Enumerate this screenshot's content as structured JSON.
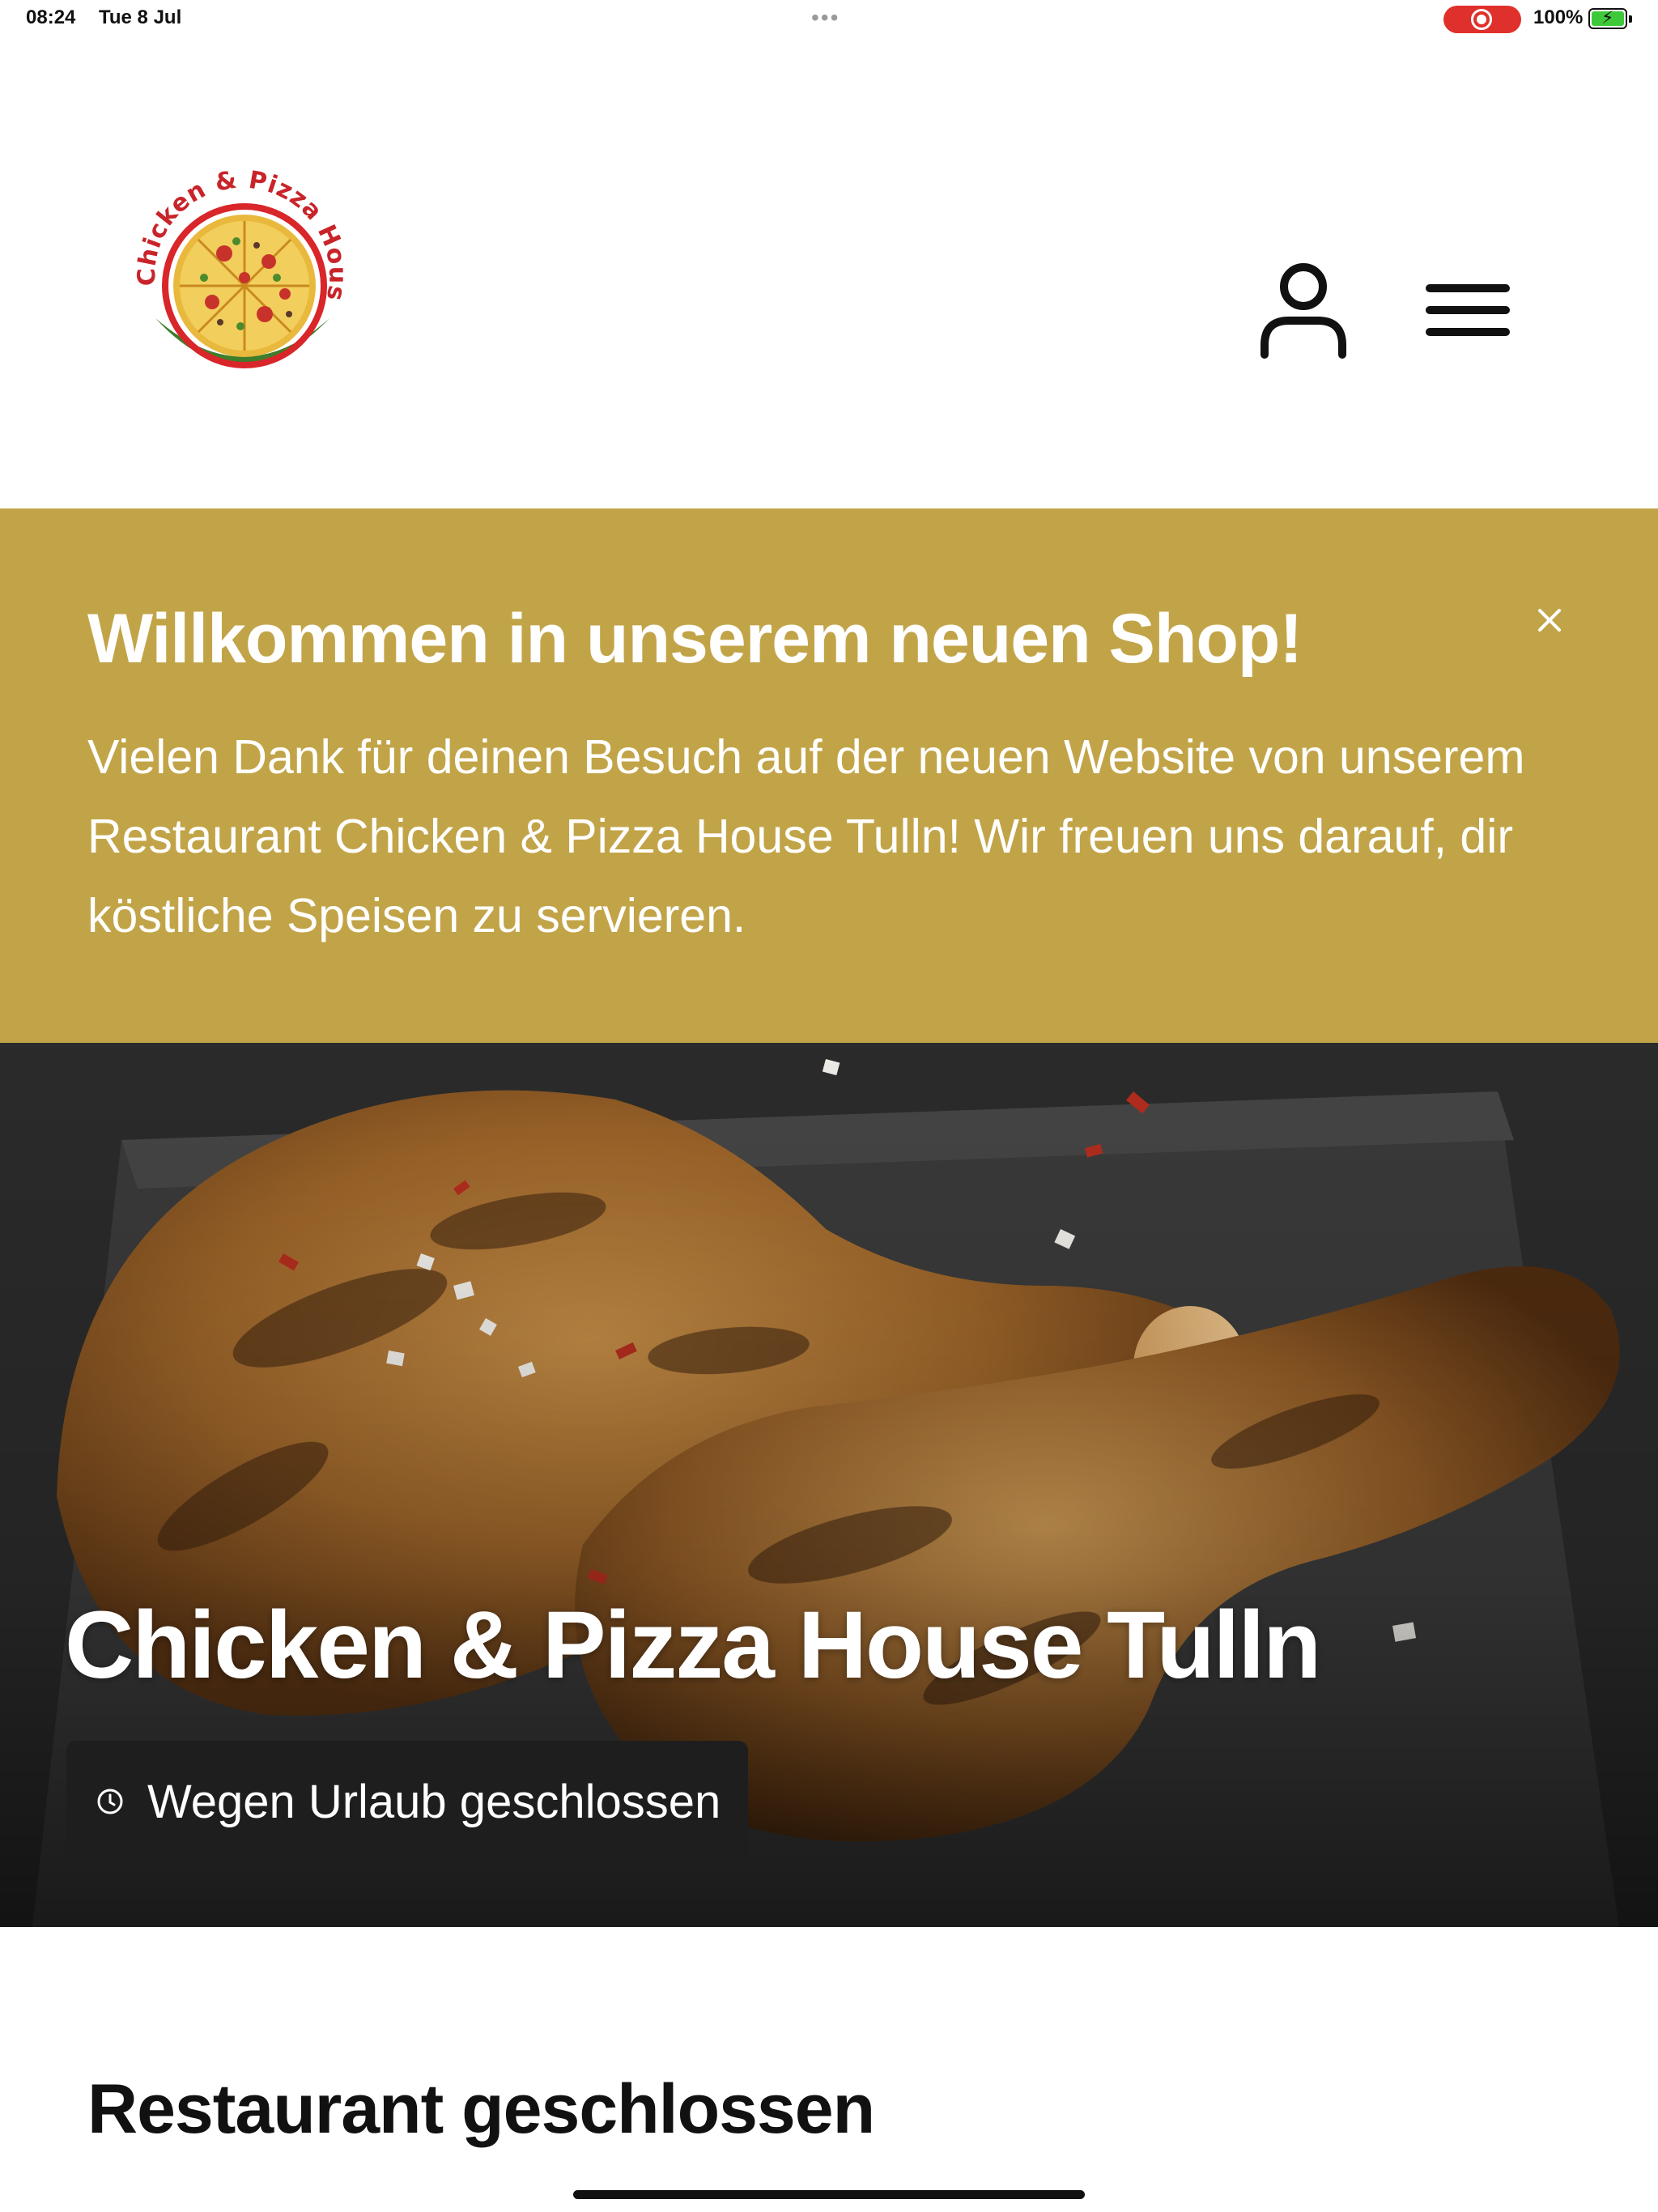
{
  "status_bar": {
    "time": "08:24",
    "date": "Tue 8 Jul",
    "battery": "100%",
    "record_color": "#e0302b",
    "battery_color": "#3ec93a"
  },
  "header": {
    "logo_text": "Chicken & Pizza House Tulln",
    "account_icon": "user-icon",
    "menu_icon": "menu-icon"
  },
  "banner": {
    "title": "Willkommen in unserem neuen Shop!",
    "text": "Vielen Dank für deinen Besuch auf der neuen Website von unserem Restaurant Chicken & Pizza House Tulln! Wir freuen uns darauf, dir köstliche Speisen zu servieren.",
    "background": "#c2a448",
    "close_icon": "close-icon"
  },
  "hero": {
    "title": "Chicken & Pizza House Tulln",
    "status": "Wegen Urlaub geschlossen",
    "status_icon": "clock-icon"
  },
  "section": {
    "title": "Restaurant geschlossen"
  }
}
